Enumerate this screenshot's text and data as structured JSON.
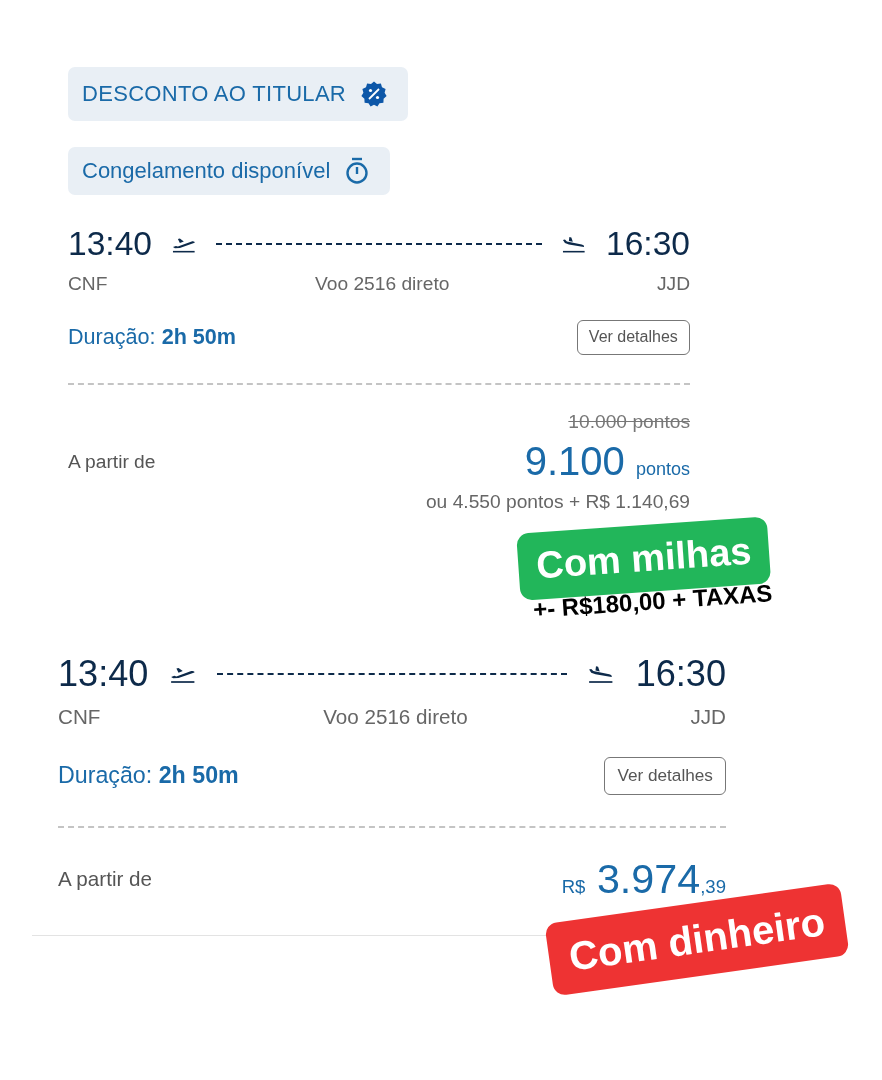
{
  "badges": [
    {
      "kind": "discount",
      "label": "DESCONTO AO TITULAR"
    },
    {
      "kind": "freeze",
      "label": "Congelamento disponível"
    }
  ],
  "flights": [
    {
      "departure_time": "13:40",
      "departure_airport": "CNF",
      "arrival_time": "16:30",
      "arrival_airport": "JJD",
      "flight_info": "Voo 2516 direto",
      "duration_label": "Duração:",
      "duration": "2h 50m",
      "details_button": "Ver detalhes",
      "price_label": "A partir de",
      "price": {
        "kind": "points",
        "original": "10.000 pontos",
        "amount": "9.100",
        "unit": "pontos",
        "alternative": "ou 4.550 pontos + R$ 1.140,69"
      },
      "sticker": {
        "label": "Com milhas",
        "color": "#22b65a",
        "note": "+- R$180,00 + TAXAS"
      }
    },
    {
      "departure_time": "13:40",
      "departure_airport": "CNF",
      "arrival_time": "16:30",
      "arrival_airport": "JJD",
      "flight_info": "Voo 2516 direto",
      "duration_label": "Duração:",
      "duration": "2h 50m",
      "details_button": "Ver detalhes",
      "price_label": "A partir de",
      "price": {
        "kind": "cash",
        "currency": "R$",
        "amount": "3.974",
        "cents": ",39"
      },
      "sticker": {
        "label": "Com dinheiro",
        "color": "#ee3333"
      }
    }
  ]
}
